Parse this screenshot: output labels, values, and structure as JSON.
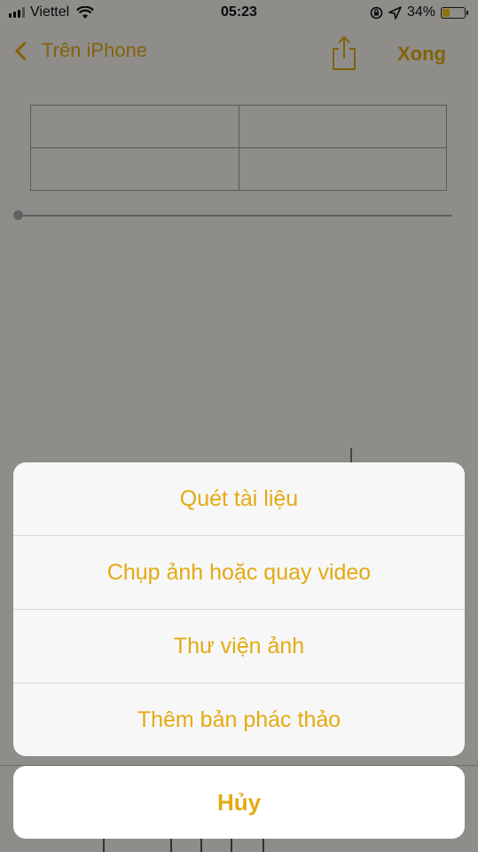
{
  "status_bar": {
    "carrier": "Viettel",
    "time": "05:23",
    "battery_percent": "34%",
    "battery_level": 0.34,
    "icons": [
      "signal-icon",
      "wifi-icon",
      "rotation-lock-icon",
      "location-icon",
      "battery-icon"
    ]
  },
  "nav": {
    "back_label": "Trên iPhone",
    "done_label": "Xong",
    "share_icon": "share-icon"
  },
  "action_sheet": {
    "items": [
      {
        "label": "Quét tài liệu"
      },
      {
        "label": "Chụp ảnh hoặc quay video"
      },
      {
        "label": "Thư viện ảnh"
      },
      {
        "label": "Thêm bản phác thảo"
      }
    ],
    "cancel_label": "Hủy"
  },
  "colors": {
    "accent": "#e3aa12",
    "sheet_bg": "#f7f7f7",
    "battery_fill": "#f5c515"
  }
}
